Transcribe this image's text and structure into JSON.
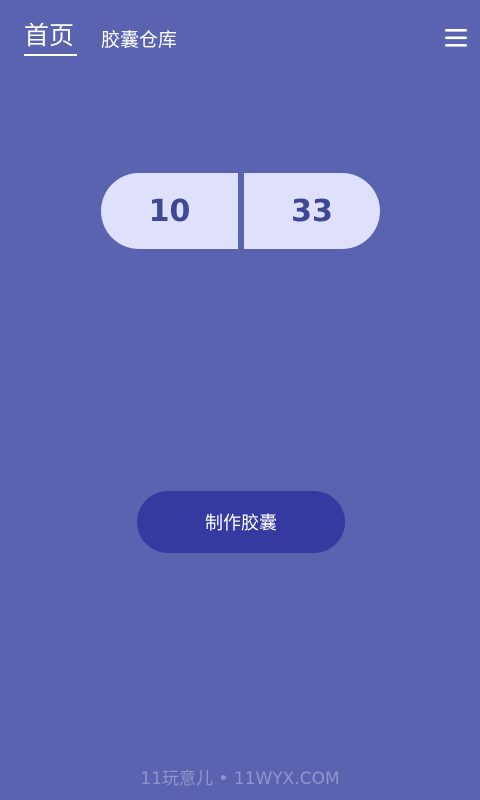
{
  "topbar": {
    "tab_home": "首页",
    "tab_warehouse": "胶囊仓库",
    "menu_icon": "hamburger-menu-icon"
  },
  "capsule": {
    "left_value": "10",
    "right_value": "33"
  },
  "actions": {
    "make_capsule_label": "制作胶囊"
  },
  "watermark": {
    "text": "11玩意儿 • 11WYX.COM"
  },
  "colors": {
    "background": "#5a63b0",
    "capsule_fill": "#dfe0fb",
    "capsule_text": "#3f4797",
    "button_fill": "#353aa0",
    "watermark": "#8f95cf"
  }
}
